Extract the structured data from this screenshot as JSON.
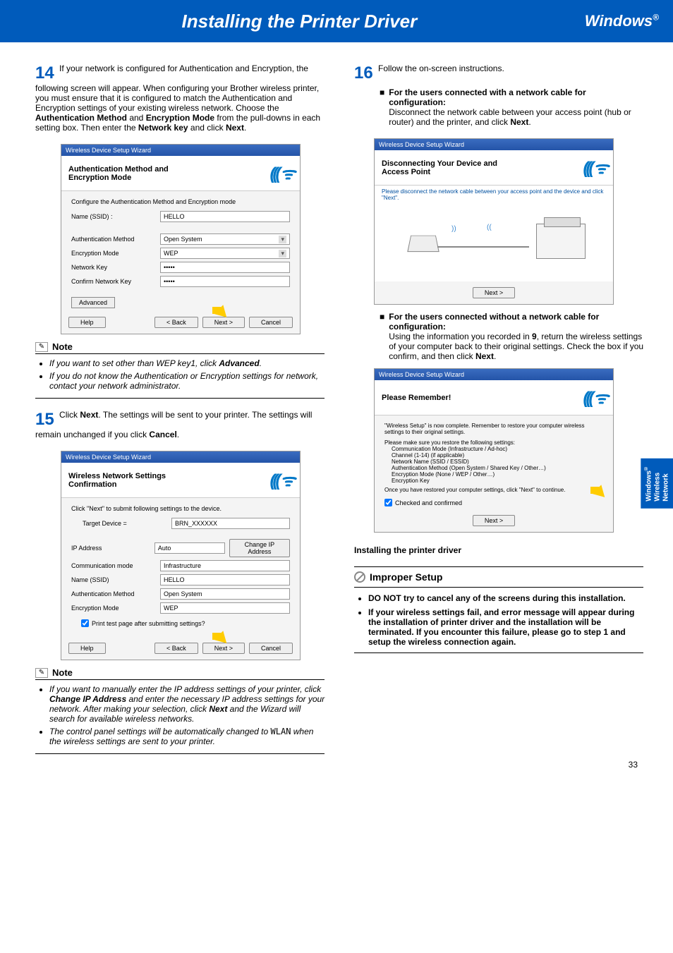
{
  "header": {
    "title": "Installing the Printer Driver",
    "platform": "Windows",
    "reg": "®"
  },
  "sideTab": {
    "l1": "Windows",
    "reg": "®",
    "l2": "Wireless",
    "l3": "Network"
  },
  "pageNumber": "33",
  "left": {
    "step14": {
      "num": "14",
      "text_parts": [
        "If your network is configured for Authentication and Encryption, the following screen will appear. When configuring your Brother wireless printer, you must ensure that it is configured to match the Authentication and Encryption settings of your existing wireless network. Choose the ",
        "Authentication Method",
        " and ",
        "Encryption Mode",
        " from the pull-downs in each setting box. Then enter the ",
        "Network key",
        " and click ",
        "Next",
        "."
      ]
    },
    "ss14": {
      "titlebar": "Wireless Device Setup Wizard",
      "title": "Authentication Method and Encryption Mode",
      "subtitle": "Configure the Authentication Method and Encryption mode",
      "rows": {
        "ssid_lbl": "Name (SSID) :",
        "ssid_val": "HELLO",
        "auth_lbl": "Authentication Method",
        "auth_val": "Open System",
        "enc_lbl": "Encryption Mode",
        "enc_val": "WEP",
        "key_lbl": "Network Key",
        "key_val": "•••••",
        "ckey_lbl": "Confirm Network Key",
        "ckey_val": "•••••"
      },
      "adv": "Advanced",
      "btns": {
        "help": "Help",
        "back": "< Back",
        "next": "Next >",
        "cancel": "Cancel"
      }
    },
    "note14": {
      "label": "Note",
      "items": [
        "If you want to set other than WEP key1, click Advanced.",
        "If you do not know the Authentication or Encryption settings for network, contact your network administrator."
      ]
    },
    "step15": {
      "num": "15",
      "text_parts": [
        "Click ",
        "Next",
        ". The settings will be sent to your printer. The settings will remain unchanged if you click ",
        "Cancel",
        "."
      ]
    },
    "ss15": {
      "titlebar": "Wireless Device Setup Wizard",
      "title": "Wireless Network Settings Confirmation",
      "subtitle": "Click \"Next\" to submit following settings to the device.",
      "rows": {
        "target_lbl": "Target Device =",
        "target_val": "BRN_XXXXXX",
        "ip_lbl": "IP Address",
        "ip_val": "Auto",
        "comm_lbl": "Communication mode",
        "comm_val": "Infrastructure",
        "ssid_lbl": "Name (SSID)",
        "ssid_val": "HELLO",
        "auth_lbl": "Authentication Method",
        "auth_val": "Open System",
        "enc_lbl": "Encryption Mode",
        "enc_val": "WEP"
      },
      "chg": "Change IP Address",
      "print_test": "Print test page after submitting settings?",
      "btns": {
        "help": "Help",
        "back": "< Back",
        "next": "Next >",
        "cancel": "Cancel"
      }
    },
    "note15": {
      "label": "Note",
      "items_html": [
        "If you want to manually enter the IP address settings of your printer, click <b>Change IP Address</b> and enter the necessary IP address settings for your network. After making your selection, click <b>Next</b> and the Wizard will search for available wireless networks.",
        "The control panel settings will be automatically changed to <span style='font-family:monospace;font-style:normal'>WLAN</span> when the wireless settings are sent to your printer."
      ]
    }
  },
  "right": {
    "step16": {
      "num": "16",
      "intro": "Follow the on-screen instructions.",
      "sub1": {
        "title": "For the users connected with a network cable for configuration:",
        "body_parts": [
          "Disconnect the network cable between your access point (hub or router) and the printer, and click ",
          "Next",
          "."
        ]
      },
      "ss16a": {
        "titlebar": "Wireless Device Setup Wizard",
        "title": "Disconnecting Your Device and Access Point",
        "subtitle": "Please disconnect the network cable between your access point and the device and click \"Next\".",
        "btn_next": "Next >"
      },
      "sub2": {
        "title": "For the users connected without a network cable for configuration:",
        "body_parts": [
          "Using the information you recorded in ",
          "9",
          ", return the wireless settings of your computer back to their original settings. Check the box if you confirm, and then click ",
          "Next",
          "."
        ]
      },
      "ss16b": {
        "titlebar": "Wireless Device Setup Wizard",
        "title": "Please Remember!",
        "msg": "\"Wireless Setup\" is now complete. Remember to restore your computer wireless settings to their original settings.",
        "list_hdr": "Please make sure you restore the following settings:",
        "items": [
          "Communication Mode (Infrastructure / Ad-hoc)",
          "Channel (1-14) (if applicable)",
          "Network Name (SSID / ESSID)",
          "Authentication Method (Open System / Shared Key / Other…)",
          "Encryption Mode (None / WEP / Other…)",
          "Encryption Key"
        ],
        "after": "Once you have restored your computer settings, click \"Next\" to continue.",
        "check": "Checked and confirmed",
        "btn_next": "Next >"
      }
    },
    "install_sub": "Installing the printer driver",
    "improper": {
      "label": "Improper Setup",
      "items": [
        "DO NOT try to cancel any of the screens during this installation.",
        "If your wireless settings fail, and error message will appear during the installation of printer driver and the installation will be terminated. If you encounter this failure, please go to step 1 and setup the wireless connection again."
      ]
    }
  }
}
